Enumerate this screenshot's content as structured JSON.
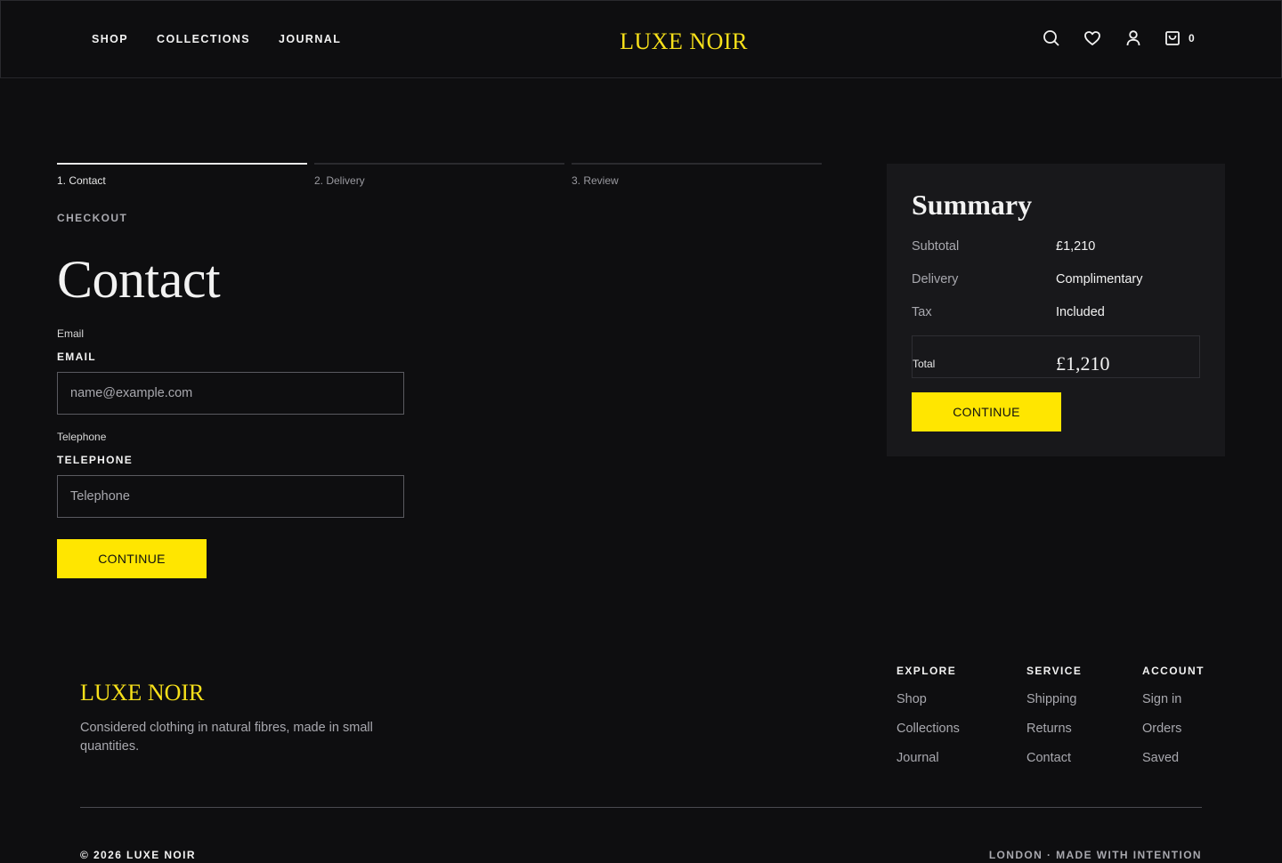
{
  "header": {
    "nav": [
      "SHOP",
      "COLLECTIONS",
      "JOURNAL"
    ],
    "logo": "LUXE NOIR",
    "cart_count": "0",
    "icons": [
      "search-icon",
      "heart-icon",
      "user-icon",
      "bag-icon"
    ]
  },
  "steps": [
    {
      "label": "1. Contact",
      "active": true
    },
    {
      "label": "2. Delivery",
      "active": false
    },
    {
      "label": "3. Review",
      "active": false
    }
  ],
  "checkout": {
    "eyebrow": "CHECKOUT",
    "title": "Contact",
    "email": {
      "small_label": "Email",
      "label": "EMAIL",
      "value": "",
      "placeholder": "name@example.com"
    },
    "telephone": {
      "small_label": "Telephone",
      "label": "TELEPHONE",
      "value": "",
      "placeholder": "Telephone"
    },
    "continue_label": "CONTINUE"
  },
  "summary": {
    "title": "Summary",
    "rows": [
      {
        "key": "Subtotal",
        "value": "£1,210"
      },
      {
        "key": "Delivery",
        "value": "Complimentary"
      },
      {
        "key": "Tax",
        "value": "Included"
      }
    ],
    "total_label": "Total",
    "total_value": "£1,210",
    "continue_label": "CONTINUE"
  },
  "footer": {
    "logo": "LUXE NOIR",
    "tagline": "Considered clothing in natural fibres, made in small quantities.",
    "columns": [
      {
        "title": "EXPLORE",
        "links": [
          "Shop",
          "Collections",
          "Journal"
        ]
      },
      {
        "title": "SERVICE",
        "links": [
          "Shipping",
          "Returns",
          "Contact"
        ]
      },
      {
        "title": "ACCOUNT",
        "links": [
          "Sign in",
          "Orders",
          "Saved"
        ]
      }
    ],
    "copyright": "© 2026 LUXE NOIR",
    "made": "LONDON · MADE WITH INTENTION"
  },
  "colors": {
    "accent": "#ffe600",
    "logo": "#f7e01a",
    "background": "#0e0e10",
    "panel": "#18181b"
  }
}
